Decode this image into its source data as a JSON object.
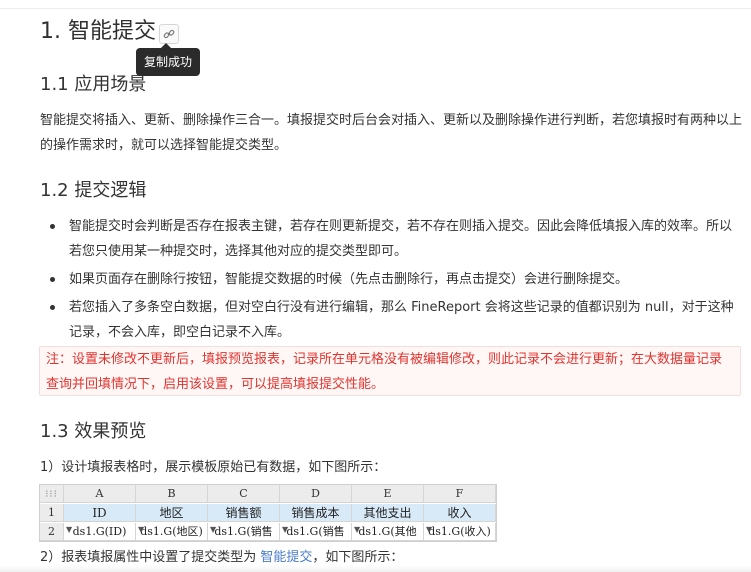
{
  "heading": {
    "title": "1. 智能提交",
    "anchor_icon": "link-icon"
  },
  "tooltip": {
    "text": "复制成功"
  },
  "section1": {
    "title": "1.1 应用场景",
    "paragraph": "智能提交将插入、更新、删除操作三合一。填报提交时后台会对插入、更新以及删除操作进行判断，若您填报时有两种以上的操作需求时，就可以选择智能提交类型。"
  },
  "section2": {
    "title": "1.2 提交逻辑",
    "items": [
      "智能提交时会判断是否存在报表主键，若存在则更新提交，若不存在则插入提交。因此会降低填报入库的效率。所以若您只使用某一种提交时，选择其他对应的提交类型即可。",
      "如果页面存在删除行按钮，智能提交数据的时候（先点击删除行，再点击提交）会进行删除提交。",
      "若您插入了多条空白数据，但对空白行没有进行编辑，那么 FineReport 会将这些记录的值都识别为 null，对于这种记录，不会入库，即空白记录不入库。"
    ],
    "note": "注：设置未修改不更新后，填报预览报表，记录所在单元格没有被编辑修改，则此记录不会进行更新；在大数据量记录查询并回填情况下，启用该设置，可以提高填报提交性能。"
  },
  "section3": {
    "title": "1.3 效果预览",
    "step1": "1）设计填报表格时，展示模板原始已有数据，如下图所示：",
    "step2_prefix": "2）报表填报属性中设置了提交类型为 ",
    "step2_link": "智能提交",
    "step2_suffix": "，如下图所示："
  },
  "spreadsheet": {
    "corner": "⁝⁝⁝",
    "columns": [
      "A",
      "B",
      "C",
      "D",
      "E",
      "F"
    ],
    "rows": [
      {
        "num": "1",
        "cells": [
          "ID",
          "地区",
          "销售额",
          "销售成本",
          "其他支出",
          "收入"
        ]
      },
      {
        "num": "2",
        "cells": [
          "ds1.G(ID)",
          "ds1.G(地区)",
          "ds1.G(销售",
          "ds1.G(销售",
          "ds1.G(其他",
          "ds1.G(收入)"
        ]
      }
    ],
    "accent_color": "#d8eaf8"
  }
}
